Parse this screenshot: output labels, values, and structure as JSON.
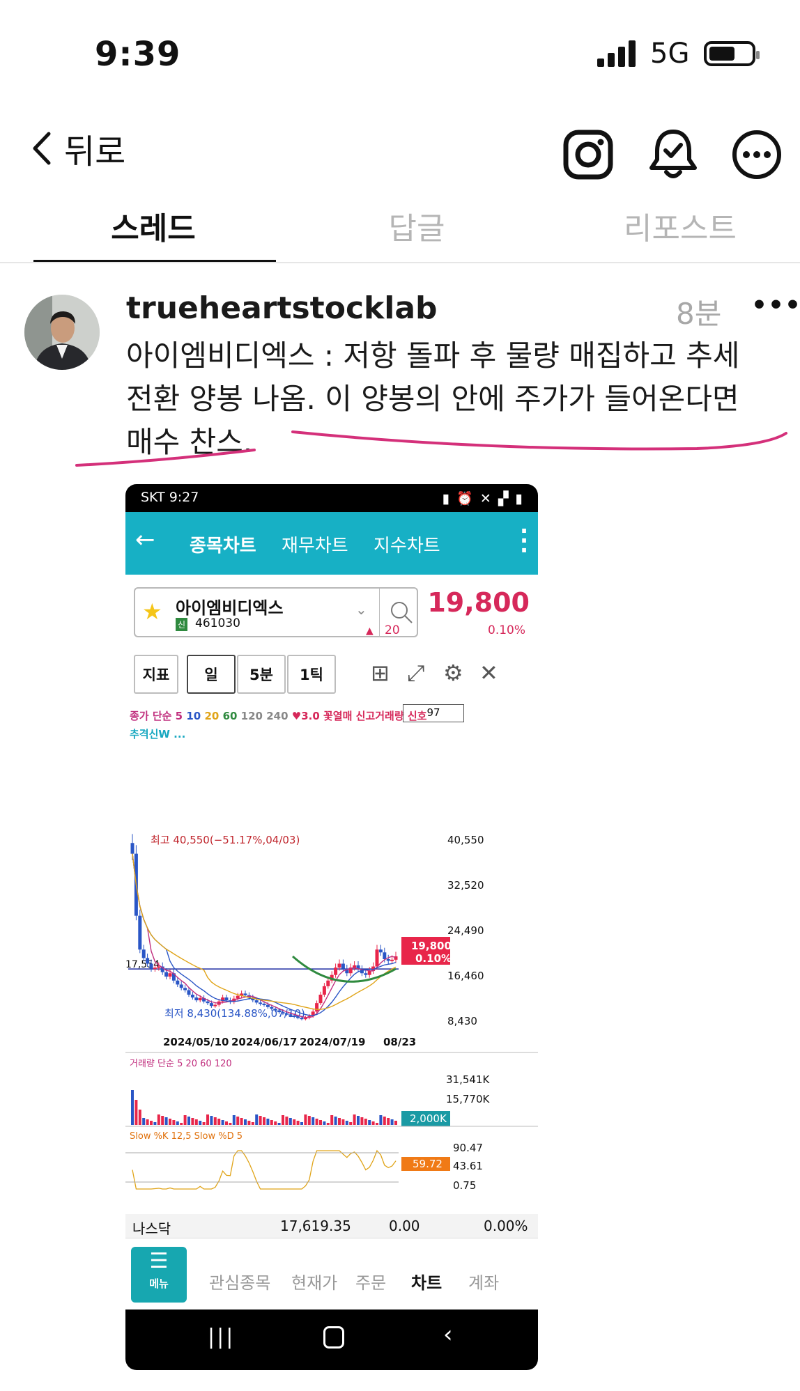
{
  "status_bar": {
    "time": "9:39",
    "network": "5G"
  },
  "header": {
    "back_label": "뒤로"
  },
  "tabs": [
    {
      "label": "스레드"
    },
    {
      "label": "답글"
    },
    {
      "label": "리포스트"
    }
  ],
  "post": {
    "username": "trueheartstocklab",
    "time_ago": "8분",
    "more": "•••",
    "text": "아이엠비디엑스 : 저항 돌파 후 물량 매집하고 추세 전환 양봉 나옴. 이 양봉의 안에 주가가 들어온다면 매수 찬스."
  },
  "phone": {
    "carrier_time": "SKT 9:27",
    "nav_tabs": [
      "종목차트",
      "재무차트",
      "지수차트"
    ],
    "stock": {
      "name": "아이엠비디엑스",
      "badge": "신",
      "code": "461030",
      "price": "19,800",
      "change": "20",
      "change_pct": "0.10%"
    },
    "toolbar": {
      "indicator": "지표",
      "day": "일",
      "min5": "5분",
      "tick1": "1틱"
    },
    "chart_legend": {
      "line1_prefix": "종가 단순",
      "ma_periods": [
        "5",
        "10",
        "20",
        "60",
        "120",
        "240"
      ],
      "extra": "♥3.0 꽃열매 신고거래량 신호",
      "line2": "추격신W ...",
      "box_value": "97"
    },
    "annotations": {
      "high": "최고 40,550(−51.17%,04/03)",
      "low": "최저 8,430(134.88%,07/10)",
      "left_level": "17,554"
    },
    "volume_legend": {
      "prefix": "거래량 단순",
      "periods": [
        "5",
        "20",
        "60",
        "120"
      ]
    },
    "stoch_legend": "Slow %K 12,5 Slow %D 5",
    "nasdaq": {
      "name": "나스닥",
      "value": "17,619.35",
      "change": "0.00",
      "pct": "0.00%"
    },
    "bottom_menu": {
      "menu": "메뉴",
      "items": [
        "관심종목",
        "현재가",
        "주문",
        "차트",
        "계좌"
      ]
    }
  },
  "chart_data": {
    "type": "candlestick",
    "price_axis_ticks": [
      "40,550",
      "32,520",
      "24,490",
      "16,460",
      "8,430"
    ],
    "date_ticks": [
      "2024/05/10",
      "2024/06/17",
      "2024/07/19",
      "08/23"
    ],
    "current_price": "19,800",
    "current_pct": "0.10%",
    "volume_ticks": [
      "31,541K",
      "15,770K"
    ],
    "volume_current": "2,000K",
    "stoch_ticks": [
      "90.47",
      "43.61",
      "0.75"
    ],
    "stoch_current": "59.72",
    "close": [
      38000,
      27000,
      21000,
      19500,
      18500,
      17600,
      17800,
      18000,
      17000,
      16200,
      16800,
      15500,
      14800,
      14200,
      13800,
      13000,
      12500,
      12000,
      12400,
      11800,
      11500,
      11000,
      11200,
      11800,
      12500,
      12000,
      11700,
      12300,
      12800,
      13200,
      12900,
      12500,
      12000,
      11600,
      11400,
      11200,
      10800,
      10500,
      10200,
      9900,
      9700,
      9500,
      9300,
      9100,
      8900,
      8700,
      8900,
      9200,
      10000,
      11500,
      13000,
      14500,
      15500,
      16500,
      17800,
      18500,
      17600,
      16800,
      17800,
      18200,
      17500,
      16800,
      16500,
      17200,
      18000,
      21000,
      20500,
      19300,
      19000,
      19200,
      19800
    ],
    "colors": {
      "up": "#e8264a",
      "down": "#2a56c6"
    }
  }
}
